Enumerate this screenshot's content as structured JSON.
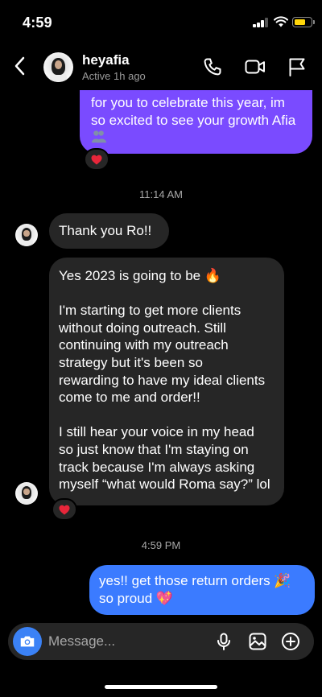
{
  "status_bar": {
    "time": "4:59"
  },
  "header": {
    "username": "heyafia",
    "active_status": "Active 1h ago"
  },
  "messages": [
    {
      "sender": "me",
      "text": "for you to celebrate this year, im\nso excited to see your growth Afia",
      "reaction": "red-heart"
    },
    {
      "type": "timestamp",
      "text": "11:14 AM"
    },
    {
      "sender": "them",
      "text": "Thank you Ro!!"
    },
    {
      "sender": "them",
      "text": "Yes 2023 is going to be 🔥\n\nI'm starting to get more clients\nwithout doing outreach. Still\ncontinuing with my outreach\nstrategy but it's been so\nrewarding to have my ideal clients\ncome to me and order!!\n\nI still hear your voice in my head\nso just know that I'm staying on\ntrack because I'm always asking\nmyself “what would Roma say?” lol",
      "reaction": "red-heart"
    },
    {
      "type": "timestamp",
      "text": "4:59 PM"
    },
    {
      "sender": "me",
      "text": "yes!! get those return orders 🎉\nso proud 💖"
    }
  ],
  "composer": {
    "placeholder": "Message..."
  },
  "colors": {
    "bubble_me_purple": "#7a4bff",
    "bubble_me_blue": "#3b7bff",
    "bubble_them": "#262626",
    "camera_button": "#3b82f6",
    "heart": "#e8263a"
  },
  "icons": [
    "back-icon",
    "phone-icon",
    "video-icon",
    "flag-icon",
    "camera-icon",
    "microphone-icon",
    "gallery-icon",
    "add-circle-icon",
    "heart-icon"
  ]
}
